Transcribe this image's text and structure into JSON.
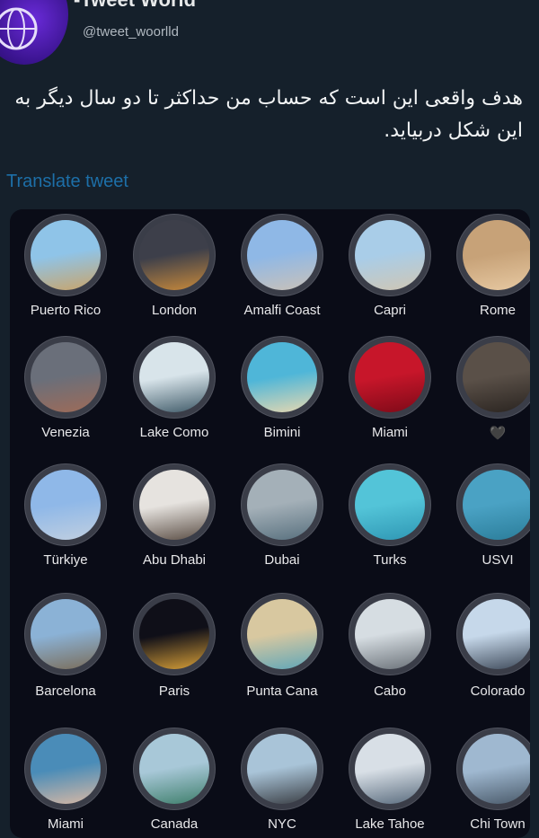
{
  "profile": {
    "display_name": "-Tweet World",
    "handle": "@tweet_woorlld"
  },
  "tweet": {
    "text": "هدف واقعی این است که حساب من حداکثر تا دو سال دیگر به این شکل دربیاید.",
    "translate_label": "Translate tweet"
  },
  "highlights": [
    {
      "label": "Puerto Rico",
      "icon": "beach-photo",
      "colors": [
        "#8fc4e8",
        "#c9a46a"
      ]
    },
    {
      "label": "London",
      "icon": "big-ben-photo",
      "colors": [
        "#3d3f4a",
        "#c98a3b"
      ]
    },
    {
      "label": "Amalfi Coast",
      "icon": "coastal-town-photo",
      "colors": [
        "#8fb8e6",
        "#c9c1b8"
      ]
    },
    {
      "label": "Capri",
      "icon": "terrace-photo",
      "colors": [
        "#a9cde8",
        "#cfc6b4"
      ]
    },
    {
      "label": "Rome",
      "icon": "colosseum-photo",
      "colors": [
        "#c7a278",
        "#e7c9a2"
      ]
    },
    {
      "label": "Venezia",
      "icon": "canal-photo",
      "colors": [
        "#6a6f7a",
        "#9e6b58"
      ]
    },
    {
      "label": "Lake Como",
      "icon": "lake-view-photo",
      "colors": [
        "#d8e4ea",
        "#3f5a68"
      ]
    },
    {
      "label": "Bimini",
      "icon": "palm-beach-photo",
      "colors": [
        "#4fb6d8",
        "#e8d8b0"
      ]
    },
    {
      "label": "Miami",
      "icon": "red-flowers-photo",
      "colors": [
        "#c7162a",
        "#7e0a18"
      ]
    },
    {
      "label": "🖤",
      "icon": "woman-portrait-photo",
      "colors": [
        "#5a5048",
        "#2a2420"
      ]
    },
    {
      "label": "Türkiye",
      "icon": "hot-air-balloon-photo",
      "colors": [
        "#8fb8e8",
        "#c0cfe0"
      ]
    },
    {
      "label": "Abu Dhabi",
      "icon": "white-mosque-photo",
      "colors": [
        "#e6e3df",
        "#5a4d44"
      ]
    },
    {
      "label": "Dubai",
      "icon": "infinity-pool-photo",
      "colors": [
        "#a4b0b8",
        "#58707e"
      ]
    },
    {
      "label": "Turks",
      "icon": "swing-water-photo",
      "colors": [
        "#53c4d8",
        "#2f97b4"
      ]
    },
    {
      "label": "USVI",
      "icon": "aerial-island-photo",
      "colors": [
        "#4aa2c4",
        "#2b7d9a"
      ]
    },
    {
      "label": "Barcelona",
      "icon": "city-skyline-photo",
      "colors": [
        "#8bb2d6",
        "#7a6d5a"
      ]
    },
    {
      "label": "Paris",
      "icon": "eiffel-tower-photo",
      "colors": [
        "#0f0f18",
        "#d8a038"
      ]
    },
    {
      "label": "Punta Cana",
      "icon": "coconut-drink-photo",
      "colors": [
        "#d8c8a0",
        "#5fa6b8"
      ]
    },
    {
      "label": "Cabo",
      "icon": "resort-photo",
      "colors": [
        "#d6dde2",
        "#6a7178"
      ]
    },
    {
      "label": "Colorado",
      "icon": "mountain-view-photo",
      "colors": [
        "#c6d8ea",
        "#3e4a5a"
      ]
    },
    {
      "label": "Miami",
      "icon": "beach-bikini-photo",
      "colors": [
        "#4a8cb8",
        "#d8b8a4"
      ]
    },
    {
      "label": "Canada",
      "icon": "niagara-falls-photo",
      "colors": [
        "#a8c8d8",
        "#3f7f6c"
      ]
    },
    {
      "label": "NYC",
      "icon": "statue-of-liberty-photo",
      "colors": [
        "#a9c4d8",
        "#3a3e44"
      ]
    },
    {
      "label": "Lake Tahoe",
      "icon": "snowy-lake-photo",
      "colors": [
        "#d8dfe6",
        "#5a6c7e"
      ]
    },
    {
      "label": "Chi Town",
      "icon": "chicago-river-photo",
      "colors": [
        "#9fb8d0",
        "#4a5a6a"
      ]
    }
  ]
}
